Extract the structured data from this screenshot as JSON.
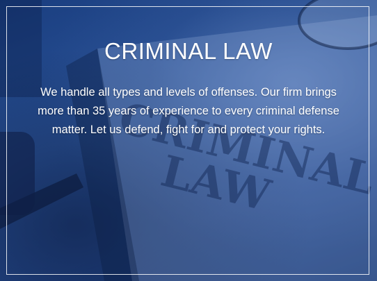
{
  "section": {
    "title": "CRIMINAL LAW",
    "description": "We handle all types and levels of offenses. Our firm brings more than 35 years of experience to every criminal defense matter. Let us defend, fight for and protect your rights."
  },
  "background": {
    "book_title_line1": "CRIMINAL",
    "book_title_line2": "LAW",
    "overlay_color": "#1c3f80"
  }
}
